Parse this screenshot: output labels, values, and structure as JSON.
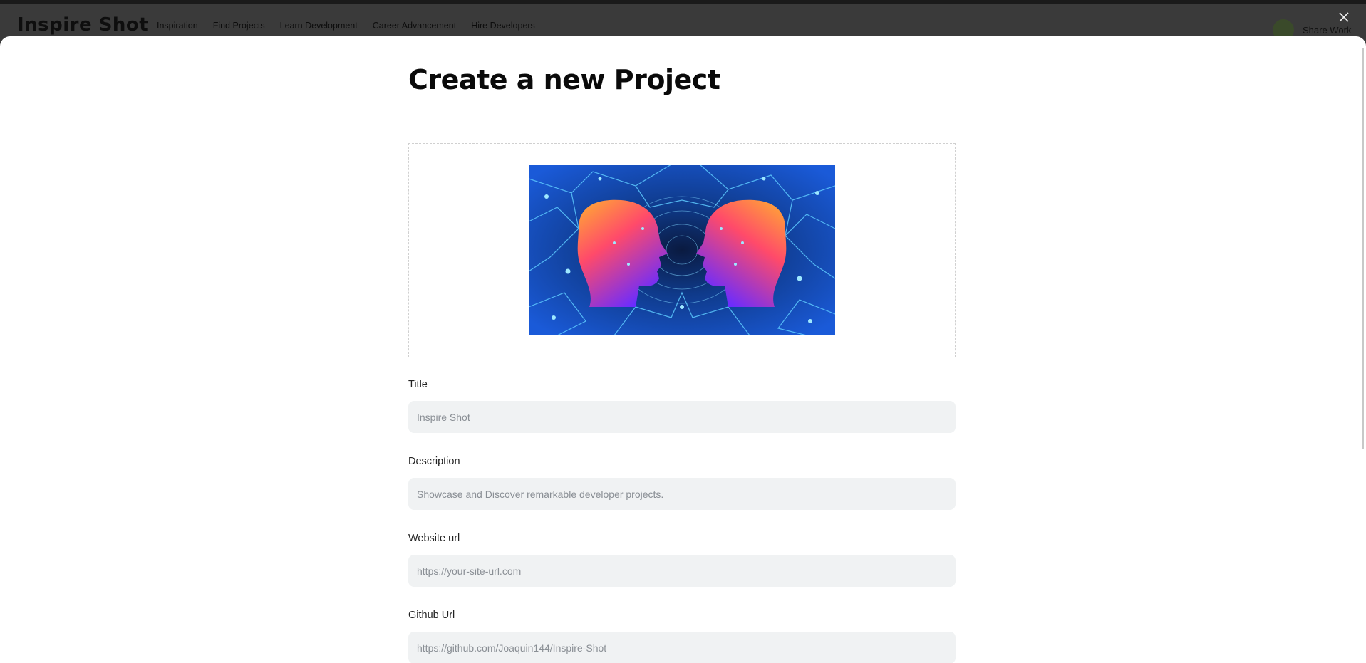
{
  "header": {
    "logo": "Inspire Shot",
    "nav": [
      {
        "label": "Inspiration"
      },
      {
        "label": "Find Projects"
      },
      {
        "label": "Learn Development"
      },
      {
        "label": "Career Advancement"
      },
      {
        "label": "Hire Developers"
      }
    ],
    "share_work": "Share Work"
  },
  "modal": {
    "title": "Create a new Project",
    "fields": {
      "title": {
        "label": "Title",
        "placeholder": "Inspire Shot"
      },
      "description": {
        "label": "Description",
        "placeholder": "Showcase and Discover remarkable developer projects."
      },
      "website": {
        "label": "Website url",
        "placeholder": "https://your-site-url.com"
      },
      "github": {
        "label": "Github Url",
        "placeholder": "https://github.com/Joaquin144/Inspire-Shot"
      }
    }
  },
  "icons": {
    "close": "close-icon",
    "avatar": "avatar"
  },
  "colors": {
    "backdrop": "#2b2b2b",
    "input_bg": "#f0f2f3",
    "placeholder": "#8a8f95"
  }
}
